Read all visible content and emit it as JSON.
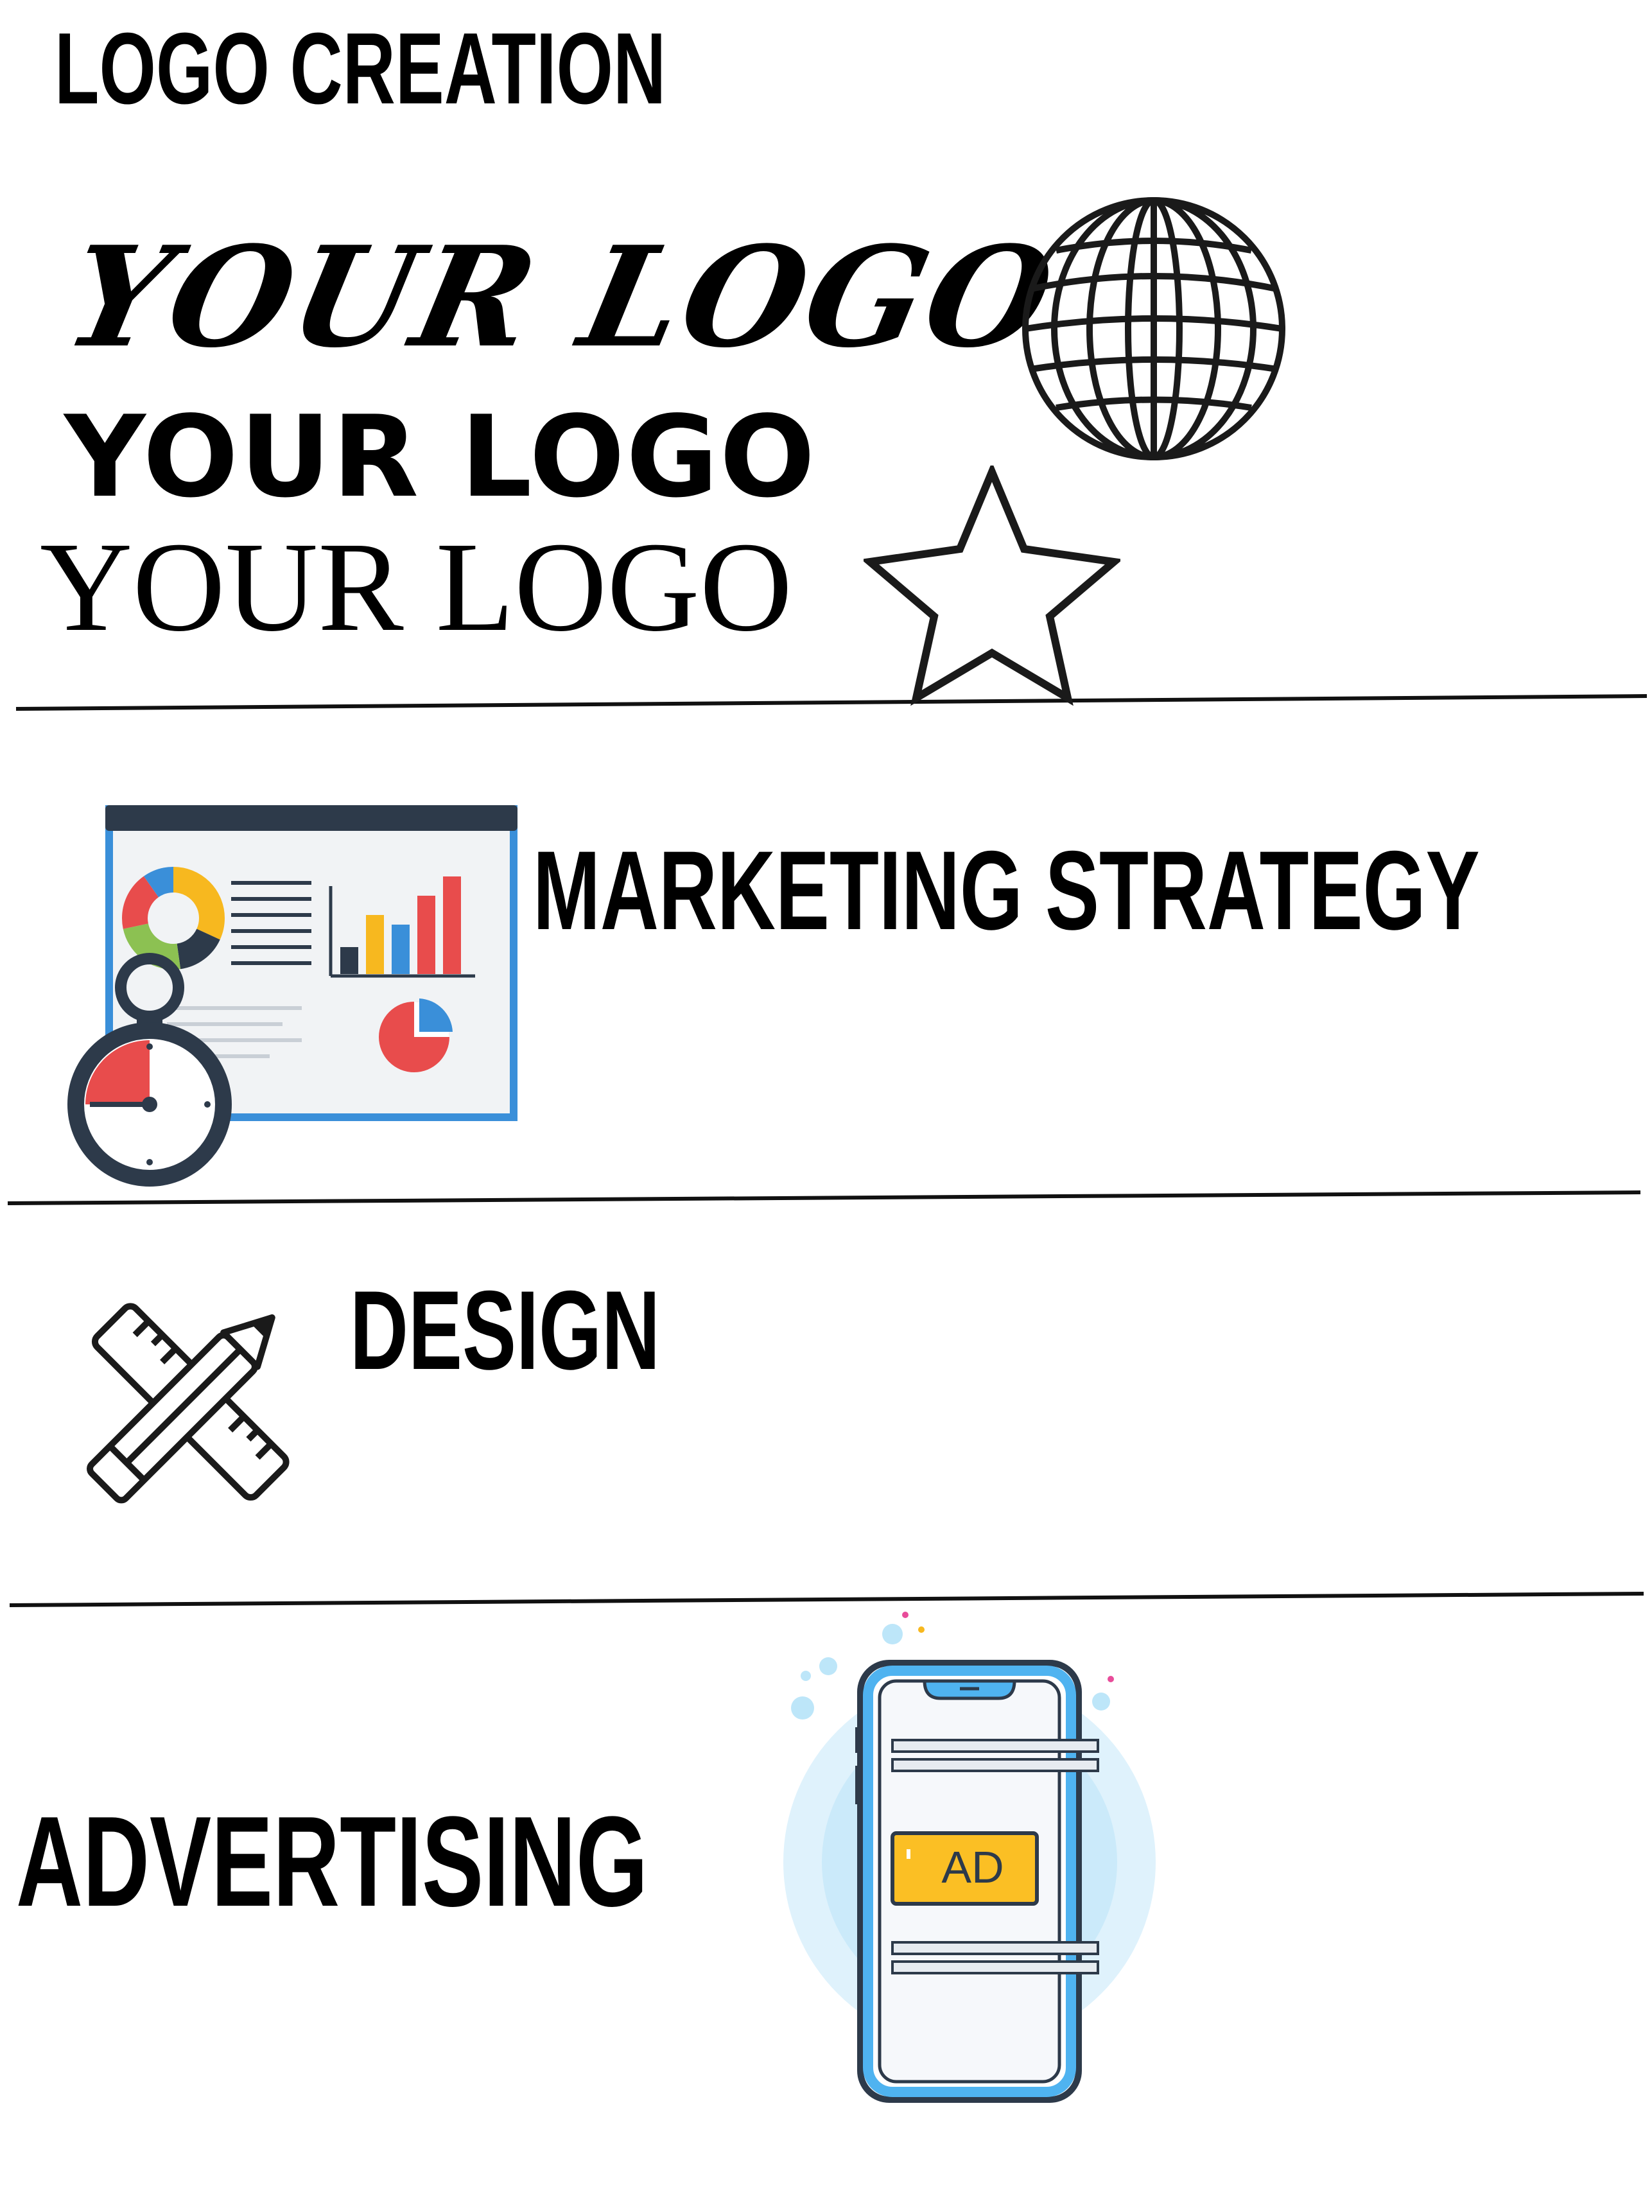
{
  "sections": {
    "logo_creation": {
      "title": "LOGO CREATION",
      "samples": [
        "YOUR LOGO",
        "YOUR LOGO",
        "YOUR LOGO"
      ],
      "icons": [
        "globe-icon",
        "star-icon"
      ]
    },
    "marketing": {
      "title": "MARKETING STRATEGY",
      "icons": [
        "dashboard-chart-icon",
        "stopwatch-icon"
      ]
    },
    "design": {
      "title": "DESIGN",
      "icons": [
        "pencil-ruler-icon"
      ]
    },
    "advertising": {
      "title": "ADVERTISING",
      "phone_ad_label": "AD",
      "icons": [
        "smartphone-ad-icon"
      ]
    }
  },
  "colors": {
    "text": "#000000",
    "dark_navy": "#2d3a4a",
    "blue": "#3a8fd9",
    "light_blue": "#4fb3f0",
    "red": "#e84c4c",
    "yellow": "#f7b81f",
    "green": "#8cc152",
    "ad_yellow": "#fbbf24"
  }
}
